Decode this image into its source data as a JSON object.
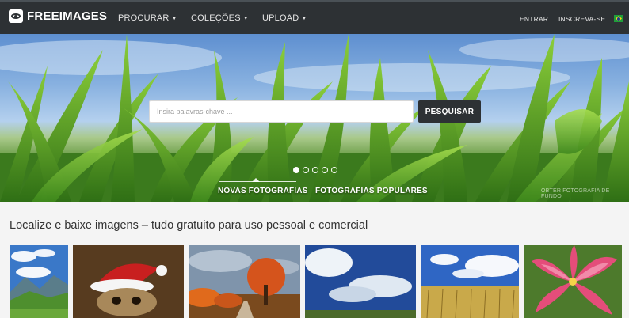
{
  "header": {
    "logo_text": "FREEIMAGES",
    "logo_icon": "eye-icon",
    "nav": [
      {
        "label": "PROCURAR"
      },
      {
        "label": "COLEÇÕES"
      },
      {
        "label": "UPLOAD"
      }
    ],
    "signin_label": "ENTRAR",
    "signup_label": "INSCREVA-SE",
    "flag_icon": "brazil-flag-icon"
  },
  "hero": {
    "search_placeholder": "Insira palavras-chave ...",
    "search_button": "PESQUISAR",
    "slide_count": 5,
    "active_slide": 1,
    "tabs": [
      {
        "label": "NOVAS FOTOGRAFIAS",
        "active": true
      },
      {
        "label": "FOTOGRAFIAS POPULARES",
        "active": false
      }
    ],
    "credit": "OBTER FOTOGRAFIA DE FUNDO"
  },
  "main": {
    "headline": "Localize e baixe imagens – tudo gratuito para uso pessoal e comercial",
    "thumbnails": [
      {
        "subject": "mountain-valley-photo"
      },
      {
        "subject": "dog-santa-hat-photo"
      },
      {
        "subject": "autumn-tree-road-photo"
      },
      {
        "subject": "cloudy-sky-photo"
      },
      {
        "subject": "wheat-field-photo"
      },
      {
        "subject": "pink-lily-photo"
      }
    ]
  },
  "colors": {
    "nav_bg": "#2d3134",
    "button_bg": "#2d3134",
    "page_bg": "#f4f4f4"
  }
}
